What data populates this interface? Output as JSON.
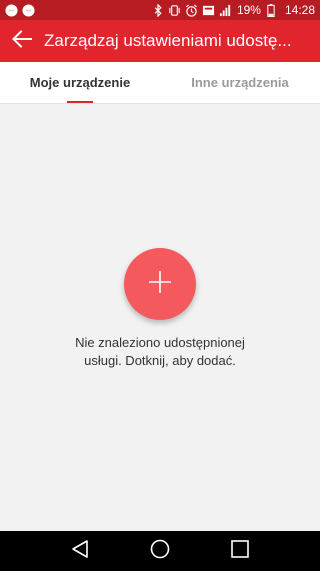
{
  "status_bar": {
    "battery": "19%",
    "time": "14:28",
    "icons": [
      "messenger-icon",
      "messenger-icon",
      "bluetooth-icon",
      "vibrate-icon",
      "alarm-icon",
      "lte-icon",
      "signal-icon",
      "battery-icon"
    ]
  },
  "app_bar": {
    "title": "Zarządzaj ustawieniami udostę..."
  },
  "tabs": [
    {
      "label": "Moje urządzenie",
      "active": true
    },
    {
      "label": "Inne urządzenia",
      "active": false
    }
  ],
  "empty_state": {
    "line1": "Nie znaleziono udostępnionej",
    "line2": "usługi. Dotknij, aby dodać."
  },
  "colors": {
    "accent": "#e0252d",
    "status_bar": "#b71c22",
    "fab": "#f4595d"
  }
}
